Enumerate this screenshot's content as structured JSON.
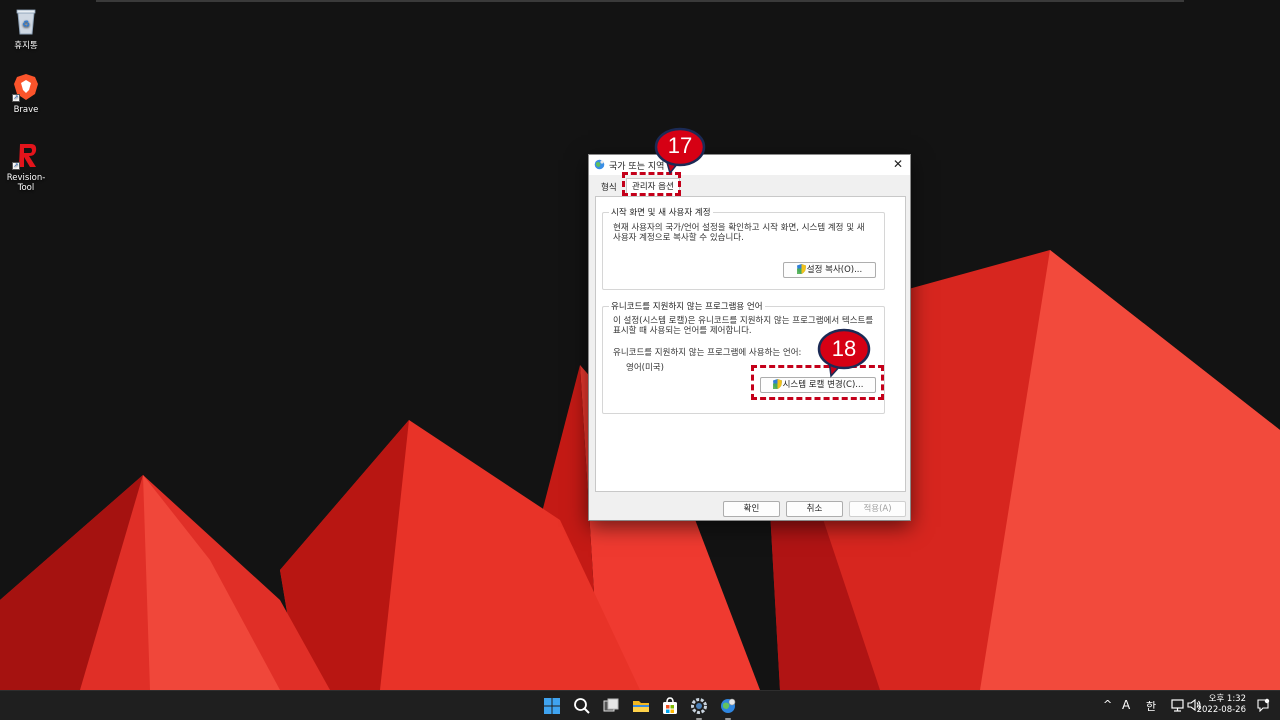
{
  "desktop": {
    "icons": [
      {
        "label": "휴지통"
      },
      {
        "label": "Brave"
      },
      {
        "label": "Revision-Tool"
      }
    ]
  },
  "dialog": {
    "title": "국가 또는 지역",
    "close_glyph": "✕",
    "tabs": [
      {
        "label": "형식",
        "selected": false
      },
      {
        "label": "관리자 옵션",
        "selected": true
      }
    ],
    "welcome_group": {
      "title": "시작 화면 및 새 사용자 계정",
      "description": "현재 사용자의 국가/언어 설정을 확인하고 시작 화면, 시스템 계정 및 새 사용자 계정으로 복사할 수 있습니다.",
      "copy_button": "설정 복사(O)..."
    },
    "unicode_group": {
      "title": "유니코드를 지원하지 않는 프로그램용 언어",
      "description": "이 설정(시스템 로캘)은 유니코드를 지원하지 않는 프로그램에서 텍스트를 표시할 때 사용되는 언어를 제어합니다.",
      "current_label": "유니코드를 지원하지 않는 프로그램에 사용하는 언어:",
      "current_value": "영어(미국)",
      "change_button": "시스템 로캘 변경(C)..."
    },
    "footer": {
      "ok": "확인",
      "cancel": "취소",
      "apply": "적용(A)"
    }
  },
  "annotations": [
    {
      "number": "17",
      "target": "관리자 옵션 tab"
    },
    {
      "number": "18",
      "target": "시스템 로캘 변경 button"
    }
  ],
  "annotation_color": "#c4001a",
  "taskbar": {
    "icons": [
      "windows-start-icon",
      "search-icon",
      "task-view-icon",
      "file-explorer-icon",
      "store-icon",
      "settings-icon",
      "region-settings-icon"
    ],
    "tray": {
      "chevron": "^",
      "input_mode": "A",
      "ime": "한",
      "time": "오후 1:32",
      "date": "2022-08-26"
    }
  }
}
